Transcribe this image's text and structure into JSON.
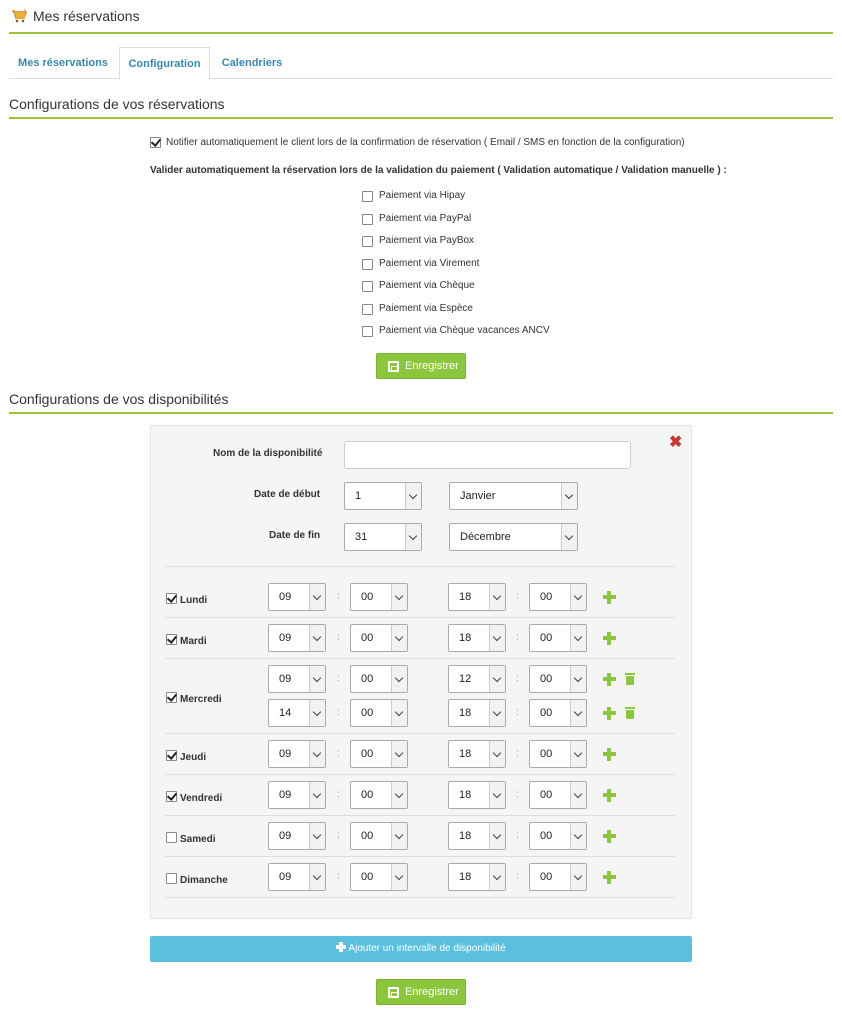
{
  "header": {
    "title": "Mes réservations",
    "icon": "cart-icon"
  },
  "tabs": [
    {
      "label": "Mes réservations",
      "active": false
    },
    {
      "label": "Configuration",
      "active": true
    },
    {
      "label": "Calendriers",
      "active": false
    }
  ],
  "reservations": {
    "title": "Configurations de vos réservations",
    "notify_label": "Notifier automatiquement le client lors de la confirmation de réservation ( Email / SMS en fonction de la configuration)",
    "notify_checked": true,
    "validate_label": "Valider automatiquement la réservation lors de la validation du paiement ( Validation automatique / Validation manuelle ) :",
    "payments": [
      {
        "label": "Paiement via Hipay",
        "checked": false
      },
      {
        "label": "Paiement via PayPal",
        "checked": false
      },
      {
        "label": "Paiement via PayBox",
        "checked": false
      },
      {
        "label": "Paiement via Virement",
        "checked": false
      },
      {
        "label": "Paiement via Chèque",
        "checked": false
      },
      {
        "label": "Paiement via Espèce",
        "checked": false
      },
      {
        "label": "Paiement via Chèque vacances ANCV",
        "checked": false
      }
    ],
    "save_label": "Enregistrer"
  },
  "availability": {
    "title": "Configurations de vos disponibilités",
    "name_label": "Nom de la disponibilité",
    "name_value": "",
    "start_label": "Date de début",
    "start_day": "1",
    "start_month": "Janvier",
    "end_label": "Date de fin",
    "end_day": "31",
    "end_month": "Décembre",
    "days": [
      {
        "name": "Lundi",
        "checked": true,
        "intervals": [
          {
            "from_h": "09",
            "from_m": "00",
            "to_h": "18",
            "to_m": "00"
          }
        ]
      },
      {
        "name": "Mardi",
        "checked": true,
        "intervals": [
          {
            "from_h": "09",
            "from_m": "00",
            "to_h": "18",
            "to_m": "00"
          }
        ]
      },
      {
        "name": "Mercredi",
        "checked": true,
        "intervals": [
          {
            "from_h": "09",
            "from_m": "00",
            "to_h": "12",
            "to_m": "00"
          },
          {
            "from_h": "14",
            "from_m": "00",
            "to_h": "18",
            "to_m": "00"
          }
        ]
      },
      {
        "name": "Jeudi",
        "checked": true,
        "intervals": [
          {
            "from_h": "09",
            "from_m": "00",
            "to_h": "18",
            "to_m": "00"
          }
        ]
      },
      {
        "name": "Vendredi",
        "checked": true,
        "intervals": [
          {
            "from_h": "09",
            "from_m": "00",
            "to_h": "18",
            "to_m": "00"
          }
        ]
      },
      {
        "name": "Samedi",
        "checked": false,
        "intervals": [
          {
            "from_h": "09",
            "from_m": "00",
            "to_h": "18",
            "to_m": "00"
          }
        ]
      },
      {
        "name": "Dimanche",
        "checked": false,
        "intervals": [
          {
            "from_h": "09",
            "from_m": "00",
            "to_h": "18",
            "to_m": "00"
          }
        ]
      }
    ],
    "separator": ":",
    "add_interval_label": "Ajouter un intervalle de disponibilité",
    "save_label": "Enregistrer"
  },
  "colors": {
    "accent_green": "#8cc63f",
    "header_line": "#9fc23a",
    "tab_blue": "#3a87ad",
    "add_blue": "#5bc0de",
    "close_red": "#c0392b"
  }
}
